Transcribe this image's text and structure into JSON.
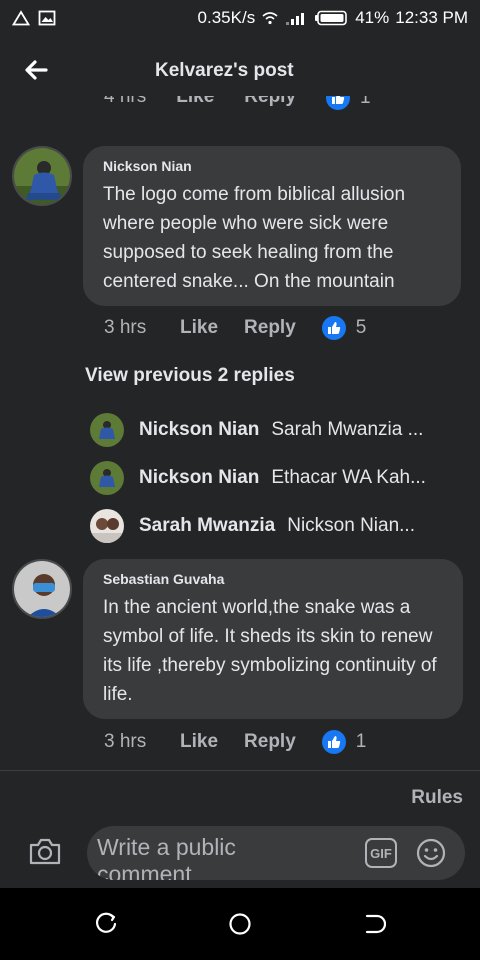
{
  "status": {
    "speed": "0.35K/s",
    "battery_pct": "41%",
    "time": "12:33 PM"
  },
  "header": {
    "title": "Kelvarez's post"
  },
  "partial_row": {
    "time": "4 hrs",
    "like": "Like",
    "reply": "Reply",
    "count": "1"
  },
  "comments": [
    {
      "author": "Nickson Nian",
      "text": "The logo come from biblical allusion where people who were sick were supposed to seek healing from the centered snake... On the mountain",
      "time": "3 hrs",
      "like": "Like",
      "reply": "Reply",
      "likes": "5"
    },
    {
      "author": "Sebastian Guvaha",
      "text": "In the ancient world,the snake was a symbol of life. It sheds its skin to renew its life ,thereby symbolizing continuity of life.",
      "time": "3 hrs",
      "like": "Like",
      "reply": "Reply",
      "likes": "1"
    }
  ],
  "view_previous": "View previous 2 replies",
  "replies": [
    {
      "author": "Nickson Nian",
      "text": "Sarah Mwanzia ..."
    },
    {
      "author": "Nickson Nian",
      "text": "Ethacar WA Kah..."
    },
    {
      "author": "Sarah Mwanzia",
      "text": "Nickson Nian..."
    }
  ],
  "rules": "Rules",
  "composer": {
    "placeholder": "Write a public comment",
    "gif": "GIF"
  },
  "colors": {
    "background": "#242526",
    "bubble": "#3a3b3c",
    "accent": "#1877f2",
    "muted": "#b0b3b8"
  },
  "icons": [
    "warning-icon",
    "image-icon",
    "wifi-icon",
    "signal-icon",
    "battery-icon",
    "back-arrow-icon",
    "like-thumb-icon",
    "camera-icon",
    "gif-icon",
    "emoji-icon",
    "recent-apps-icon",
    "home-icon",
    "back-icon"
  ]
}
